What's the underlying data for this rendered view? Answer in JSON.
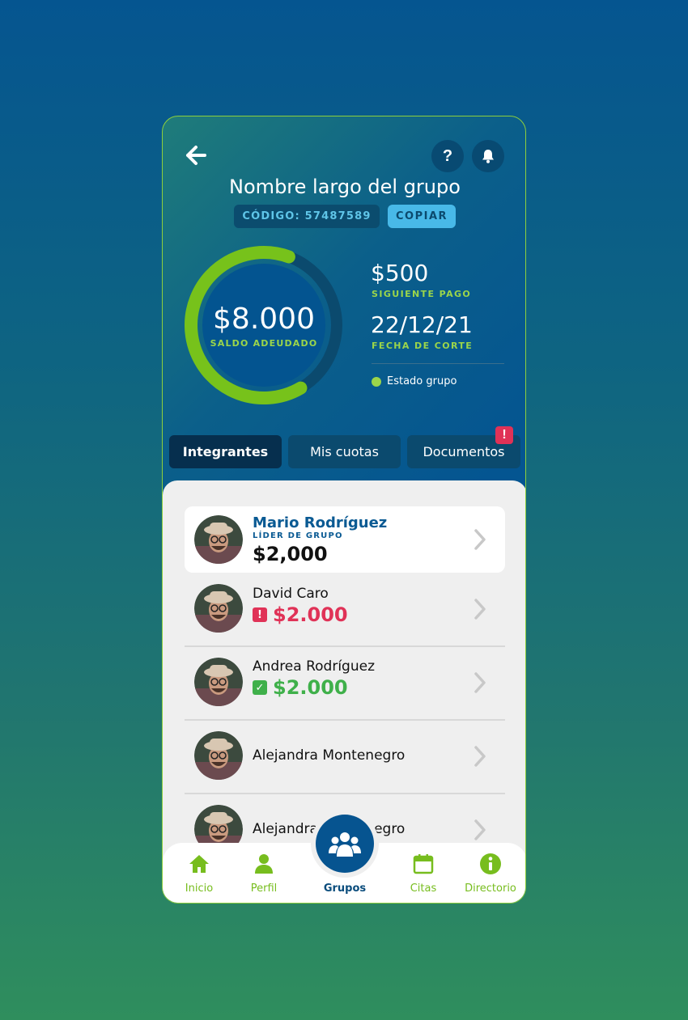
{
  "header": {
    "title": "Nombre largo del grupo",
    "code_label": "CÓDIGO: 57487589",
    "copy_label": "COPIAR"
  },
  "summary": {
    "balance": "$8.000",
    "balance_label": "SALDO ADEUDADO",
    "balance_progress": 0.64,
    "next_payment": "$500",
    "next_payment_label": "SIGUIENTE PAGO",
    "cutoff_date": "22/12/21",
    "cutoff_label": "FECHA DE CORTE",
    "status_label": "Estado grupo"
  },
  "tabs": [
    {
      "label": "Integrantes",
      "active": true
    },
    {
      "label": "Mis cuotas",
      "active": false
    },
    {
      "label": "Documentos",
      "active": false,
      "alert": "!"
    }
  ],
  "members": [
    {
      "name": "Mario Rodríguez",
      "role": "LÍDER DE GRUPO",
      "amount": "$2,000",
      "status": "leader"
    },
    {
      "name": "David Caro",
      "amount": "$2.000",
      "status": "overdue"
    },
    {
      "name": "Andrea Rodríguez",
      "amount": "$2.000",
      "status": "paid"
    },
    {
      "name": "Alejandra Montenegro",
      "amount": "",
      "status": "none"
    },
    {
      "name": "Alejandra Montenegro",
      "amount": "",
      "status": "none"
    }
  ],
  "nav": {
    "items": [
      {
        "label": "Inicio",
        "icon": "home-icon"
      },
      {
        "label": "Perfil",
        "icon": "user-icon"
      },
      {
        "label": "Grupos",
        "icon": "group-icon",
        "active": true
      },
      {
        "label": "Citas",
        "icon": "calendar-icon"
      },
      {
        "label": "Directorio",
        "icon": "info-icon"
      }
    ]
  },
  "colors": {
    "accent_green": "#9bd54a",
    "primary_blue": "#065490",
    "alert_red": "#e03257",
    "paid_green": "#3fb04a"
  }
}
